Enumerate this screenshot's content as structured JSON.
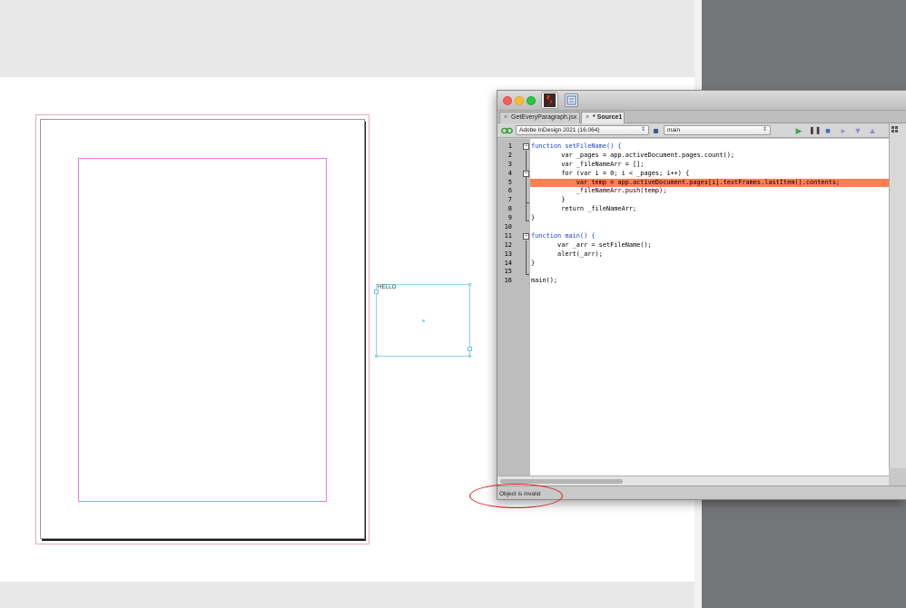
{
  "canvas": {
    "text_frame_label": "HELLO"
  },
  "estk": {
    "tabs": [
      {
        "label": "GetEveryParagraph.jsx",
        "close": "×",
        "active": false
      },
      {
        "label": "* Source1",
        "close": "×",
        "active": true
      }
    ],
    "toolbar": {
      "target_app": "Adobe InDesign 2021 (16.064)",
      "engine": "main"
    },
    "line_numbers": [
      "1",
      "2",
      "3",
      "4",
      "5",
      "6",
      "7",
      "8",
      "9",
      "10",
      "11",
      "12",
      "13",
      "14",
      "15",
      "16"
    ],
    "code": [
      "function setFileName() {",
      "        var _pages = app.activeDocument.pages.count();",
      "        var _fileNameArr = [];",
      "        for (var i = 0; i < _pages; i++) {",
      "            var temp = app.activeDocument.pages[i].textFrames.lastItem().contents;",
      "            _fileNameArr.push(temp);",
      "        }",
      "        return _fileNameArr;",
      "}",
      "",
      "function main() {",
      "       var _arr = setFileName();",
      "       alert(_arr);",
      "}",
      "",
      "main();"
    ],
    "highlighted_line": 5,
    "status_text": "Object is invalid"
  },
  "colors": {
    "highlight": "#ff7f50",
    "keyword": "#1f3fd6",
    "annotation": "#d41c1c",
    "margin_guide": "#e37ce6",
    "frame_edge": "#8fd0ee"
  }
}
